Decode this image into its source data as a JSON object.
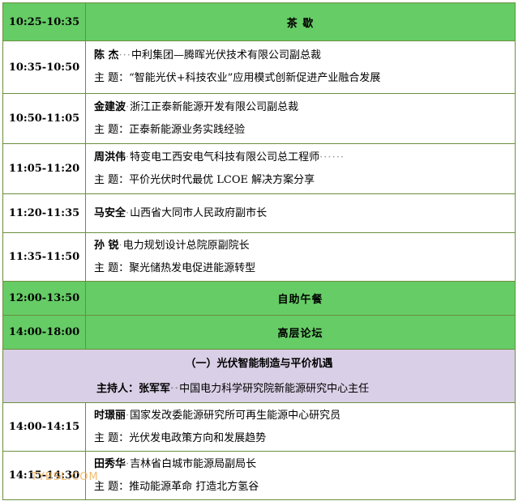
{
  "rows": {
    "r1": {
      "time": "10:25-10:35",
      "title": "茶  歇"
    },
    "r2": {
      "time": "10:35-10:50",
      "name": "陈  杰",
      "org": "中利集团—腾晖光伏技术有限公司副总裁",
      "topic_label": "主  题：",
      "topic": "“智能光伏+科技农业”应用模式创新促进产业融合发展"
    },
    "r3": {
      "time": "10:50-11:05",
      "name": "金建波",
      "org": "浙江正泰新能源开发有限公司副总裁",
      "topic_label": "主  题：",
      "topic": "正泰新能源业务实践经验"
    },
    "r4": {
      "time": "11:05-11:20",
      "name": "周洪伟",
      "org": "特变电工西安电气科技有限公司总工程师",
      "topic_label": "主  题：",
      "topic": "平价光伏时代最优 LCOE 解决方案分享"
    },
    "r5": {
      "time": "11:20-11:35",
      "name": "马安全",
      "org": "山西省大同市人民政府副市长"
    },
    "r6": {
      "time": "11:35-11:50",
      "name": "孙  锐",
      "org": "电力规划设计总院原副院长",
      "topic_label": "主  题：",
      "topic": "聚光储热发电促进能源转型"
    },
    "r7": {
      "time": "12:00-13:50",
      "title": "自助午餐"
    },
    "r8": {
      "time": "14:00-18:00",
      "title": "高层论坛"
    },
    "section": {
      "title": "（一）光伏智能制造与平价机遇",
      "host_label": "主持人：",
      "host_name": "张军军",
      "host_org": "中国电力科学研究院新能源研究中心主任"
    },
    "r9": {
      "time": "14:00-14:15",
      "name": "时璟丽",
      "org": "国家发改委能源研究所可再生能源中心研究员",
      "topic_label": "主  题：",
      "topic": "光伏发电政策方向和发展趋势"
    },
    "r10": {
      "time": "14:15-14:30",
      "name": "田秀华",
      "org": "吉林省白城市能源局副局长",
      "topic_label": "主  题：",
      "topic": "推动能源革命 打造北方氢谷"
    }
  },
  "watermark": "TYBSL.COM"
}
